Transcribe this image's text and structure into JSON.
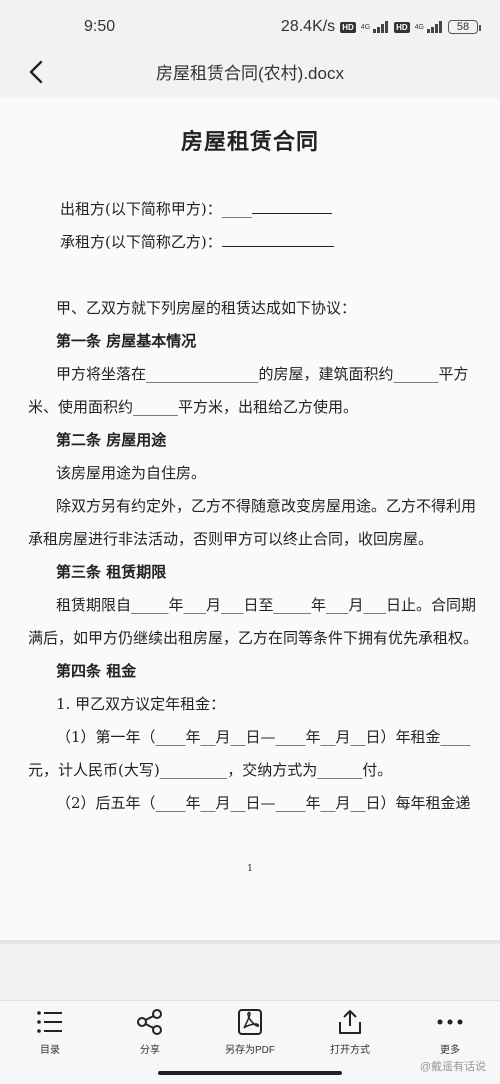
{
  "status_bar": {
    "time": "9:50",
    "net_speed": "28.4K/s",
    "hd_badge": "HD",
    "signal_text": "4G",
    "battery": "58"
  },
  "title_bar": {
    "title": "房屋租赁合同(农村).docx"
  },
  "document": {
    "heading": "房屋租赁合同",
    "lessor": "出租方(以下简称甲方)：____",
    "lessee": "承租方(以下简称乙方)：",
    "intro": "甲、乙双方就下列房屋的租赁达成如下协议：",
    "art1_title": "第一条 房屋基本情况",
    "art1_line1": "甲方将坐落在_______________的房屋，建筑面积约______平方",
    "art1_line2": "米、使用面积约______平方米，出租给乙方使用。",
    "art2_title": "第二条 房屋用途",
    "art2_line1": "该房屋用途为自住房。",
    "art2_line2": "除双方另有约定外，乙方不得随意改变房屋用途。乙方不得利用",
    "art2_line3": "承租房屋进行非法活动，否则甲方可以终止合同，收回房屋。",
    "art3_title": "第三条 租赁期限",
    "art3_line1": "租赁期限自_____年___月___日至_____年___月___日止。合同期",
    "art3_line2": "满后，如甲方仍继续出租房屋，乙方在同等条件下拥有优先承租权。",
    "art4_title": "第四条 租金",
    "art4_line1": "1. 甲乙双方议定年租金：",
    "art4_line2": "（1）第一年（____年__月__日—____年__月__日）年租金____",
    "art4_line3": "元，计人民币(大写)_________，交纳方式为______付。",
    "art4_line4": "（2）后五年（____年__月__日—____年__月__日）每年租金递",
    "page_number": "1"
  },
  "toolbar": {
    "items": [
      {
        "label": "目录",
        "icon": "list-icon"
      },
      {
        "label": "分享",
        "icon": "share-icon"
      },
      {
        "label": "另存为PDF",
        "icon": "pdf-icon"
      },
      {
        "label": "打开方式",
        "icon": "upload-icon"
      },
      {
        "label": "更多",
        "icon": "more-icon"
      }
    ]
  },
  "watermark": "@戴遥有话说"
}
